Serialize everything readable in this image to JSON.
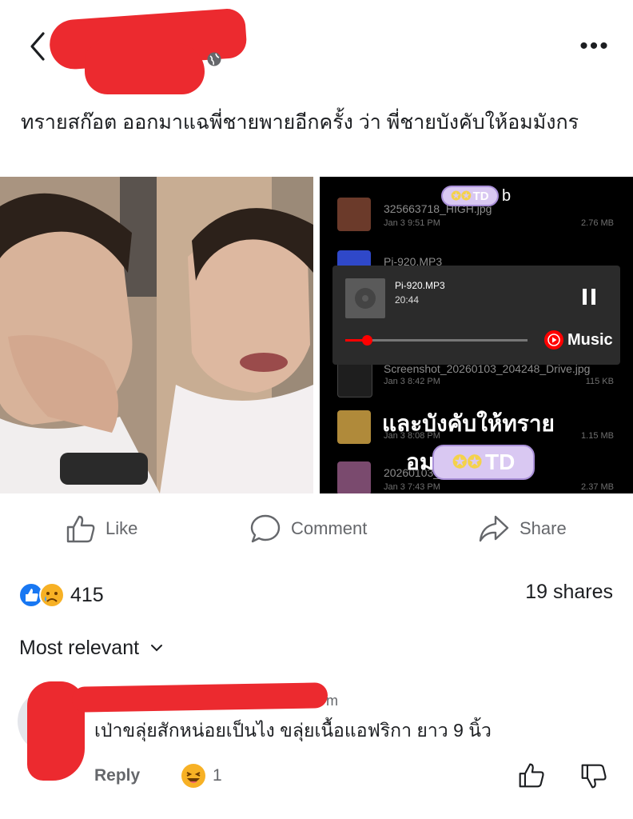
{
  "header": {
    "back_icon": "chevron-left-icon",
    "more_label": "•••",
    "privacy_icon": "globe-icon"
  },
  "post": {
    "caption": "ทรายสก๊อต ออกมาแฉพี่ชายพายอีกครั้ง ว่า พี่ชายบังคับให้อมมังกร"
  },
  "media": {
    "files": [
      {
        "name": "325663718_HIGH.jpg",
        "meta": "Jan 3 9:51 PM",
        "size": "2.76 MB"
      },
      {
        "name": "Pi-920.MP3",
        "meta": "",
        "size": ""
      },
      {
        "name": "Screenshot_20260103_204248_Drive.jpg",
        "meta": "Jan 3 8:42 PM",
        "size": "115 KB"
      },
      {
        "name": "",
        "meta": "Jan 3 8:08 PM",
        "size": "1.15 MB"
      },
      {
        "name": "20260103_",
        "meta": "Jan 3 7:43 PM",
        "size": "2.37 MB"
      }
    ],
    "player": {
      "track": "Pi-920.MP3",
      "time": "20:44",
      "brand": "Music",
      "progress": 0.12
    },
    "overlay_line1": "และบังคับให้ทราย",
    "overlay_line2": "อม",
    "sticker_top": "TD",
    "sticker_top_suffix": "b",
    "sticker_bottom": "TD"
  },
  "actions": {
    "like": "Like",
    "comment": "Comment",
    "share": "Share"
  },
  "stats": {
    "reactions_count": "415",
    "shares": "19 shares"
  },
  "comments": {
    "sort_label": "Most relevant",
    "items": [
      {
        "time_fragment": "m",
        "text": "เป่าขลุ่ยสักหน่อยเป็นไง ขลุ่ยเนื้อแอฟริกา ยาว 9 นิ้ว",
        "reply_label": "Reply",
        "reaction_count": "1"
      }
    ]
  },
  "colors": {
    "redaction": "#ec2a2f",
    "like_blue": "#1877f2",
    "muted": "#65676b",
    "youtube_red": "#ff0000"
  }
}
